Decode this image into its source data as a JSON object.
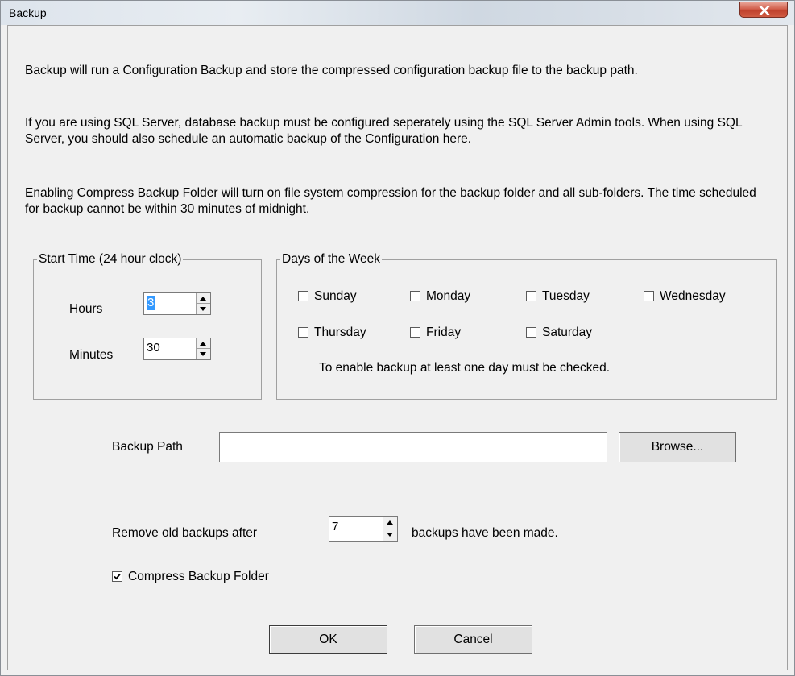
{
  "window": {
    "title": "Backup"
  },
  "intro": {
    "p1": "Backup will run a Configuration Backup and store the compressed configuration backup file to the backup path.",
    "p2": "If you are using SQL Server, database backup must be configured seperately using the SQL Server Admin tools. When using SQL Server, you should also schedule an automatic backup of the Configuration here.",
    "p3": "Enabling Compress Backup Folder will turn on file system compression for the backup folder and all sub-folders. The time scheduled for backup cannot be within 30 minutes of midnight."
  },
  "start_time": {
    "legend": "Start Time (24 hour clock)",
    "hours_label": "Hours",
    "hours_value": "3",
    "minutes_label": "Minutes",
    "minutes_value": "30"
  },
  "days": {
    "legend": "Days of the Week",
    "items": [
      {
        "label": "Sunday",
        "checked": false
      },
      {
        "label": "Monday",
        "checked": false
      },
      {
        "label": "Tuesday",
        "checked": false
      },
      {
        "label": "Wednesday",
        "checked": false
      },
      {
        "label": "Thursday",
        "checked": false
      },
      {
        "label": "Friday",
        "checked": false
      },
      {
        "label": "Saturday",
        "checked": false
      }
    ],
    "note": "To enable backup at least one day must be checked."
  },
  "backup_path": {
    "label": "Backup Path",
    "value": "",
    "browse_label": "Browse..."
  },
  "remove_old": {
    "prefix": "Remove old backups after",
    "value": "7",
    "suffix": "backups have been made."
  },
  "compress": {
    "label": "Compress Backup Folder",
    "checked": true
  },
  "buttons": {
    "ok": "OK",
    "cancel": "Cancel"
  },
  "icons": {
    "close": "close-icon",
    "spin_up": "spin-up-icon",
    "spin_down": "spin-down-icon",
    "check": "checkmark-icon"
  },
  "colors": {
    "selection": "#3399ff",
    "close_button": "#c7503b",
    "dialog_bg": "#f0f0f0"
  }
}
